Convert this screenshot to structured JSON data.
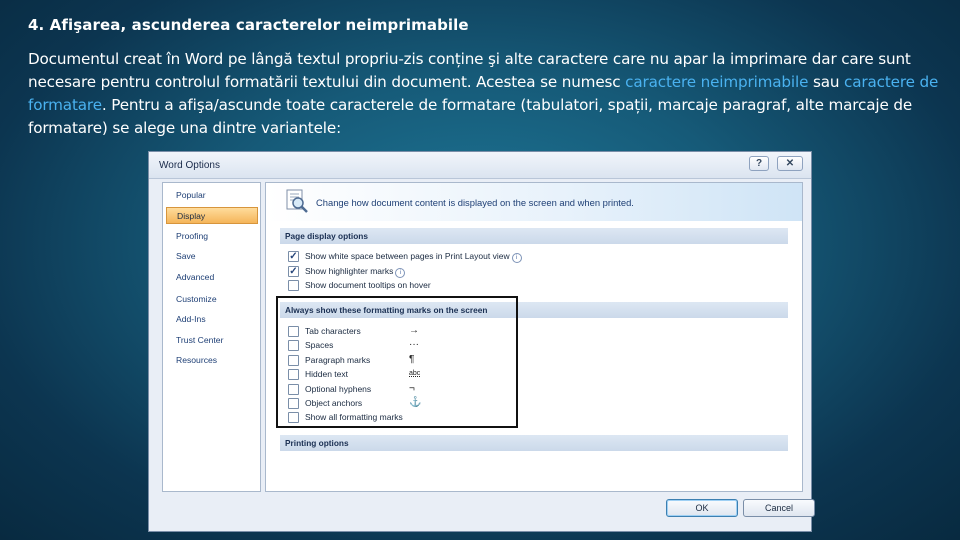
{
  "slide": {
    "title": "4. Afişarea, ascunderea caracterelor neimprimabile",
    "body": {
      "part1": "Documentul creat în Word pe lângă textul propriu-zis conține şi alte caractere care nu apar la imprimare dar care sunt necesare pentru controlul formatării textului din document. Acestea se numesc ",
      "highlight1": "caractere neimprimabile",
      "part2": " sau ",
      "highlight2": "caractere de formatare",
      "part3": ". Pentru a afişa/ascunde toate caracterele de formatare (tabulatori, spații, marcaje paragraf, alte marcaje de formatare) se alege una dintre variantele:"
    },
    "highlight_color": "#4ab2f0"
  },
  "dialog": {
    "title": "Word Options",
    "help_label": "?",
    "close_label": "✕",
    "sidebar": {
      "items": [
        {
          "label": "Popular",
          "active": false
        },
        {
          "label": "Display",
          "active": true
        },
        {
          "label": "Proofing",
          "active": false
        },
        {
          "label": "Save",
          "active": false
        },
        {
          "label": "Advanced",
          "active": false
        },
        {
          "label": "Customize",
          "active": false
        },
        {
          "label": "Add-Ins",
          "active": false
        },
        {
          "label": "Trust Center",
          "active": false
        },
        {
          "label": "Resources",
          "active": false
        }
      ]
    },
    "banner_text": "Change how document content is displayed on the screen and when printed.",
    "banner_icon": "magnifier-document-icon",
    "sections": {
      "page_display": {
        "header": "Page display options",
        "options": [
          {
            "label": "Show white space between pages in Print Layout view",
            "checked": true,
            "info_icon": "i"
          },
          {
            "label": "Show highlighter marks",
            "checked": true,
            "info_icon": "i"
          },
          {
            "label": "Show document tooltips on hover",
            "checked": false
          }
        ]
      },
      "formatting_marks": {
        "header": "Always show these formatting marks on the screen",
        "options": [
          {
            "label": "Tab characters",
            "checked": false,
            "symbol": "→"
          },
          {
            "label": "Spaces",
            "checked": false,
            "symbol": "···"
          },
          {
            "label": "Paragraph marks",
            "checked": false,
            "symbol": "¶"
          },
          {
            "label": "Hidden text",
            "checked": false,
            "symbol": "abc"
          },
          {
            "label": "Optional hyphens",
            "checked": false,
            "symbol": "¬"
          },
          {
            "label": "Object anchors",
            "checked": false,
            "symbol": "⚓"
          },
          {
            "label": "Show all formatting marks",
            "checked": false
          }
        ]
      },
      "printing": {
        "header": "Printing options"
      }
    },
    "checkmark": "✓",
    "buttons": {
      "ok": "OK",
      "cancel": "Cancel"
    }
  }
}
